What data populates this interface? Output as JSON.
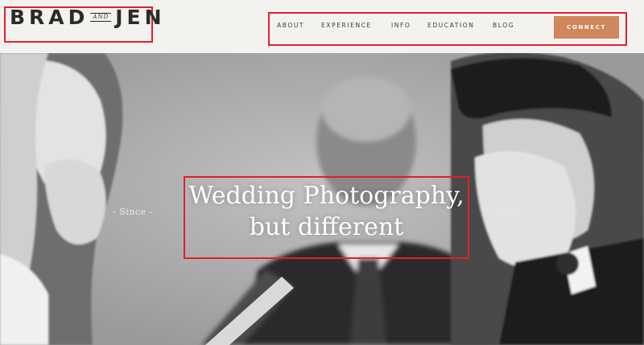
{
  "brand": {
    "first": "BRAD",
    "and": "AND",
    "second": "JEN"
  },
  "nav": {
    "items": [
      "ABOUT",
      "EXPERIENCE",
      "INFO",
      "EDUCATION",
      "BLOG"
    ],
    "cta_label": "CONNECT"
  },
  "hero": {
    "headline_line1": "Wedding Photography,",
    "headline_line2": "but different",
    "since_label": "- Since -",
    "year_label": "- 2009 -"
  },
  "colors": {
    "cta_bg": "#d0875b",
    "page_bg": "#f4f2ef",
    "highlight": "#e0202a"
  }
}
